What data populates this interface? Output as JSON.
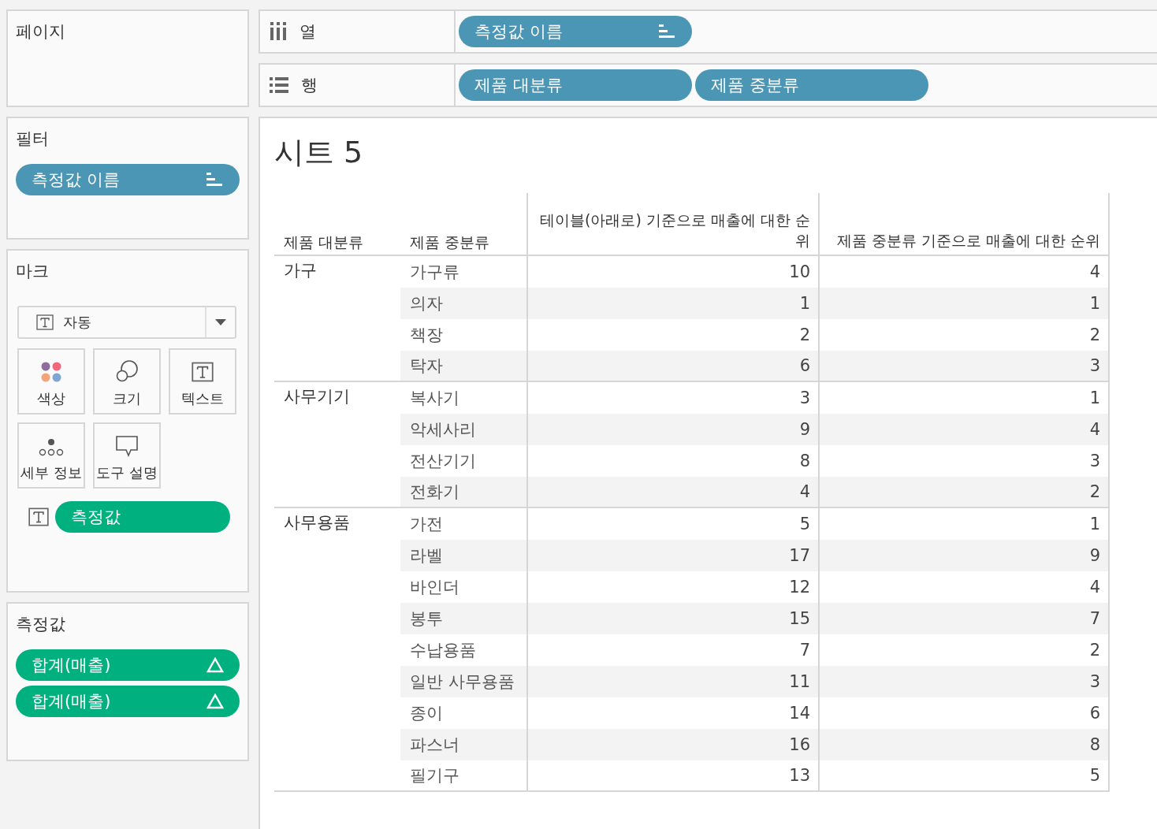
{
  "pages_shelf": {
    "title": "페이지"
  },
  "columns_shelf": {
    "label": "열",
    "pills": [
      {
        "text": "측정값 이름",
        "kind": "sorted"
      }
    ]
  },
  "rows_shelf": {
    "label": "행",
    "pills": [
      {
        "text": "제품 대분류"
      },
      {
        "text": "제품 중분류"
      }
    ]
  },
  "filters": {
    "title": "필터",
    "pills": [
      {
        "text": "측정값 이름",
        "kind": "sorted"
      }
    ]
  },
  "marks": {
    "title": "마크",
    "mark_type": "자동",
    "cards": [
      {
        "label": "색상",
        "kind": "color"
      },
      {
        "label": "크기",
        "kind": "size"
      },
      {
        "label": "텍스트",
        "kind": "text"
      },
      {
        "label": "세부 정보",
        "kind": "detail"
      },
      {
        "label": "도구 설명",
        "kind": "tooltip"
      }
    ],
    "pills": [
      {
        "text": "측정값"
      }
    ]
  },
  "measure_values": {
    "title": "측정값",
    "pills": [
      {
        "text": "합계(매출)",
        "kind": "table-calc"
      },
      {
        "text": "합계(매출)",
        "kind": "table-calc"
      }
    ]
  },
  "sheet": {
    "title": "시트 5",
    "columns": [
      "제품 대분류",
      "제품 중분류",
      "테이블(아래로) 기준으로 매출에 대한 순위",
      "제품 중분류 기준으로 매출에 대한 순위"
    ],
    "groups": [
      {
        "category": "가구",
        "rows": [
          [
            "가구류",
            "10",
            "4"
          ],
          [
            "의자",
            "1",
            "1"
          ],
          [
            "책장",
            "2",
            "2"
          ],
          [
            "탁자",
            "6",
            "3"
          ]
        ]
      },
      {
        "category": "사무기기",
        "rows": [
          [
            "복사기",
            "3",
            "1"
          ],
          [
            "악세사리",
            "9",
            "4"
          ],
          [
            "전산기기",
            "8",
            "3"
          ],
          [
            "전화기",
            "4",
            "2"
          ]
        ]
      },
      {
        "category": "사무용품",
        "rows": [
          [
            "가전",
            "5",
            "1"
          ],
          [
            "라벨",
            "17",
            "9"
          ],
          [
            "바인더",
            "12",
            "4"
          ],
          [
            "봉투",
            "15",
            "7"
          ],
          [
            "수납용품",
            "7",
            "2"
          ],
          [
            "일반 사무용품",
            "11",
            "3"
          ],
          [
            "종이",
            "14",
            "6"
          ],
          [
            "파스너",
            "16",
            "8"
          ],
          [
            "필기구",
            "13",
            "5"
          ]
        ]
      }
    ]
  }
}
